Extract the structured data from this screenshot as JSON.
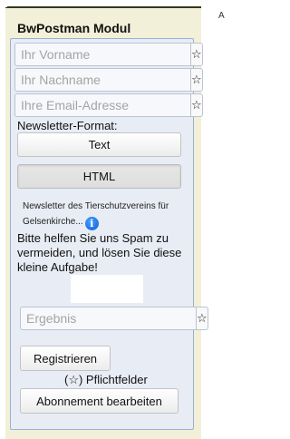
{
  "module": {
    "title": "BwPostman Modul",
    "edge_letter": "A"
  },
  "form": {
    "fields": [
      {
        "placeholder": "Ihr Vorname",
        "addon_symbol": "☆"
      },
      {
        "placeholder": "Ihr Nachname",
        "addon_symbol": "☆"
      },
      {
        "placeholder": "Ihre Email-Adresse",
        "addon_symbol": "☆"
      }
    ],
    "format_label": "Newsletter-Format:",
    "format_options": [
      {
        "label": "Text",
        "selected": false
      },
      {
        "label": "HTML",
        "selected": true
      }
    ],
    "newsletter_name": "Newsletter des Tierschutzvereins für Gelsenkirche...",
    "info_icon_glyph": "i",
    "spam_text": "Bitte helfen Sie uns Spam zu vermeiden, und lösen Sie diese kleine Aufgabe!",
    "result_field": {
      "placeholder": "Ergebnis",
      "addon_symbol": "☆"
    },
    "register_label": "Registrieren",
    "required_note": "(☆) Pflichtfelder",
    "edit_subscription_label": "Abonnement bearbeiten"
  },
  "colors": {
    "module_bg": "#f2f0d8",
    "panel_bg": "#e8ecf4",
    "panel_border": "#9ab0cf",
    "info_icon": "#0a5bd6"
  }
}
